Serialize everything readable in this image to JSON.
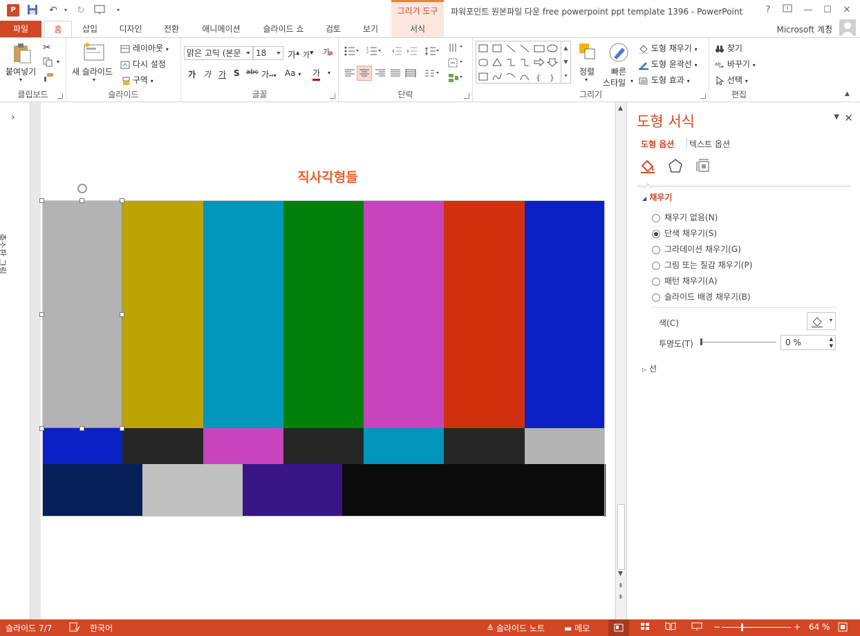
{
  "titlebar": {
    "context_group": "그리기 도구",
    "window_title": "파워포인트 원본파일 다운 free powerpoint ppt template 1396 - PowerPoint"
  },
  "tabs": [
    {
      "label": "파일"
    },
    {
      "label": "홈"
    },
    {
      "label": "삽입"
    },
    {
      "label": "디자인"
    },
    {
      "label": "전환"
    },
    {
      "label": "애니메이션"
    },
    {
      "label": "슬라이드 쇼"
    },
    {
      "label": "검토"
    },
    {
      "label": "보기"
    },
    {
      "label": "서식"
    }
  ],
  "account": "Microsoft 계정",
  "ribbon": {
    "clipboard": {
      "label": "클립보드",
      "paste": "붙여넣기"
    },
    "slides": {
      "label": "슬라이드",
      "new_slide": "새 슬라이드",
      "layout": "레이아웃",
      "reset": "다시 설정",
      "section": "구역"
    },
    "font": {
      "label": "글꼴",
      "font_name": "맑은 고딕 (본문",
      "font_size": "18",
      "spacing": "가",
      "case": "Aa",
      "font_color": "가"
    },
    "paragraph": {
      "label": "단락"
    },
    "drawing": {
      "label": "그리기",
      "arrange": "정렬",
      "quick_styles": "빠른\n스타일",
      "quick_1": "빠른",
      "quick_2": "스타일",
      "fill": "도형 채우기",
      "outline": "도형 윤곽선",
      "effects": "도형 효과"
    },
    "editing": {
      "label": "편집",
      "find": "찾기",
      "replace": "바꾸기",
      "select": "선택"
    }
  },
  "thumbnail_pane": {
    "label": "축소판 그림"
  },
  "slide": {
    "title": "직사각형들",
    "bars_top": [
      "#b3b3b3",
      "#bba404",
      "#0196bc",
      "#008009",
      "#c844be",
      "#d0300c",
      "#0b21c6"
    ],
    "bars_mid": [
      "#0b21c6",
      "#262626",
      "#c844be",
      "#262626",
      "#0196bc",
      "#262626",
      "#b3b3b3"
    ],
    "bars_bottom": [
      "#061f57",
      "#c0c0c0",
      "#371584",
      "#0b0b0b"
    ]
  },
  "format_pane": {
    "title": "도형 서식",
    "tab_shape": "도형 옵션",
    "tab_text": "텍스트 옵션",
    "fill_section": "채우기",
    "fill_options": [
      {
        "label": "채우기 없음(N)",
        "selected": false
      },
      {
        "label": "단색 채우기(S)",
        "selected": true
      },
      {
        "label": "그라데이션 채우기(G)",
        "selected": false
      },
      {
        "label": "그림 또는 질감 채우기(P)",
        "selected": false
      },
      {
        "label": "패턴 채우기(A)",
        "selected": false
      },
      {
        "label": "슬라이드 배경 채우기(B)",
        "selected": false
      }
    ],
    "color_label": "색(C)",
    "transparency_label": "투명도(T)",
    "transparency_value": "0 %",
    "line_section": "선"
  },
  "statusbar": {
    "slide_info": "슬라이드 7/7",
    "language": "한국어",
    "notes": "슬라이드 노트",
    "comments": "메모",
    "zoom": "64 %"
  },
  "colors": {
    "accent": "#d24726",
    "title_orange": "#e8622c"
  }
}
